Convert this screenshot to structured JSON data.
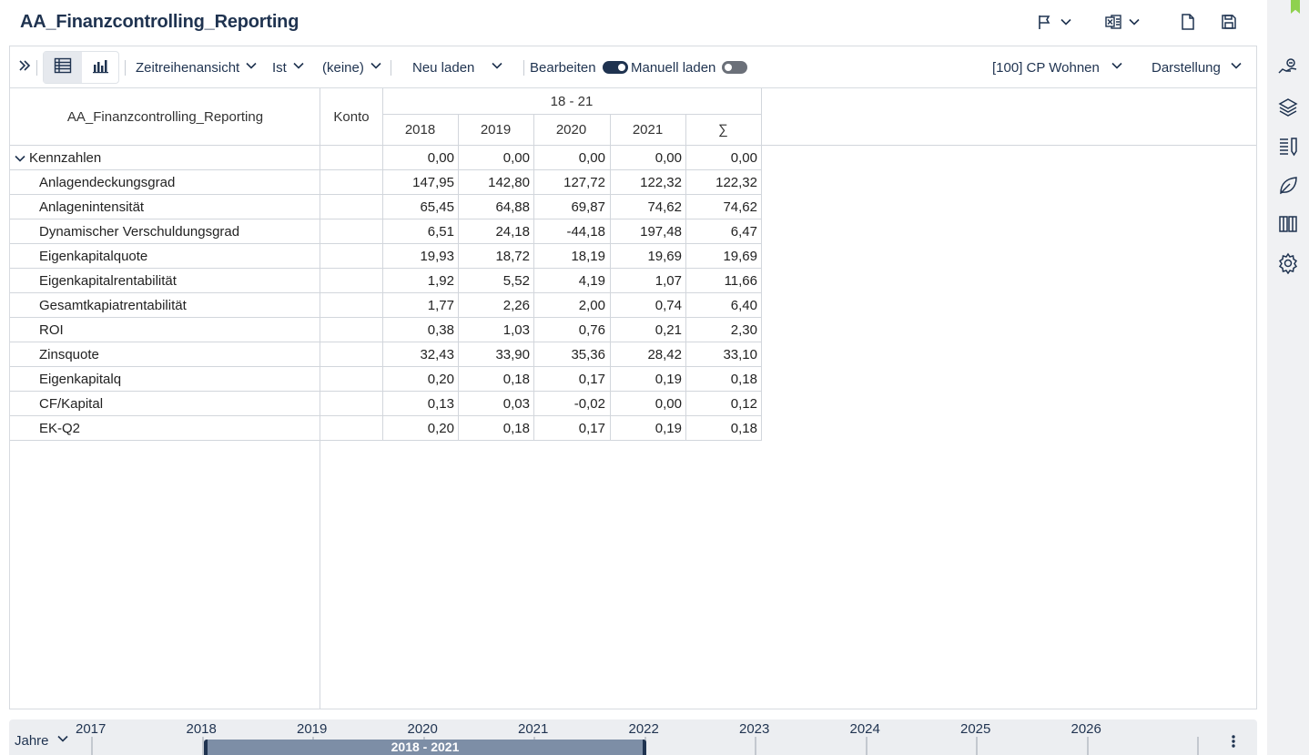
{
  "title": "AA_Finanzcontrolling_Reporting",
  "top_icons": [
    "flag-icon",
    "excel-icon",
    "document-icon",
    "save-icon"
  ],
  "toolbar": {
    "view_mode": "Zeitreihenansicht",
    "scenario": "Ist",
    "comparison": "(keine)",
    "reload_label": "Neu laden",
    "edit_label": "Bearbeiten",
    "edit_on": true,
    "manual_load_label": "Manuell laden",
    "manual_load_on": false,
    "unit": "[100] CP Wohnen",
    "display_label": "Darstellung"
  },
  "table": {
    "row_header_title": "AA_Finanzcontrolling_Reporting",
    "konto_header": "Konto",
    "period_group": "18 - 21",
    "columns": [
      "2018",
      "2019",
      "2020",
      "2021",
      "∑"
    ],
    "group_label": "Kennzahlen",
    "group_values": [
      "0,00",
      "0,00",
      "0,00",
      "0,00",
      "0,00"
    ],
    "rows": [
      {
        "label": "Anlagendeckungsgrad",
        "values": [
          "147,95",
          "142,80",
          "127,72",
          "122,32",
          "122,32"
        ]
      },
      {
        "label": "Anlagenintensität",
        "values": [
          "65,45",
          "64,88",
          "69,87",
          "74,62",
          "74,62"
        ]
      },
      {
        "label": "Dynamischer Verschuldungsgrad",
        "values": [
          "6,51",
          "24,18",
          "-44,18",
          "197,48",
          "6,47"
        ]
      },
      {
        "label": "Eigenkapitalquote",
        "values": [
          "19,93",
          "18,72",
          "18,19",
          "19,69",
          "19,69"
        ]
      },
      {
        "label": "Eigenkapitalrentabilität",
        "values": [
          "1,92",
          "5,52",
          "4,19",
          "1,07",
          "11,66"
        ]
      },
      {
        "label": "Gesamtkapiatrentabilität",
        "values": [
          "1,77",
          "2,26",
          "2,00",
          "0,74",
          "6,40"
        ]
      },
      {
        "label": "ROI",
        "values": [
          "0,38",
          "1,03",
          "0,76",
          "0,21",
          "2,30"
        ]
      },
      {
        "label": "Zinsquote",
        "values": [
          "32,43",
          "33,90",
          "35,36",
          "28,42",
          "33,10"
        ]
      },
      {
        "label": "Eigenkapitalq",
        "values": [
          "0,20",
          "0,18",
          "0,17",
          "0,19",
          "0,18"
        ]
      },
      {
        "label": "CF/Kapital",
        "values": [
          "0,13",
          "0,03",
          "-0,02",
          "0,00",
          "0,12"
        ]
      },
      {
        "label": "EK-Q2",
        "values": [
          "0,20",
          "0,18",
          "0,17",
          "0,19",
          "0,18"
        ]
      }
    ]
  },
  "timeline": {
    "granularity": "Jahre",
    "years": [
      "2017",
      "2018",
      "2019",
      "2020",
      "2021",
      "2022",
      "2023",
      "2024",
      "2025",
      "2026"
    ],
    "selected_range": "2018 - 2021"
  },
  "rail_icons": [
    "hand-coins-icon",
    "layers-icon",
    "list-edit-icon",
    "leaf-icon",
    "book-icon",
    "settings-icon"
  ],
  "colors": {
    "primary": "#1f3350",
    "accent": "#8fd14f",
    "range_fill": "#7d8ea6"
  }
}
